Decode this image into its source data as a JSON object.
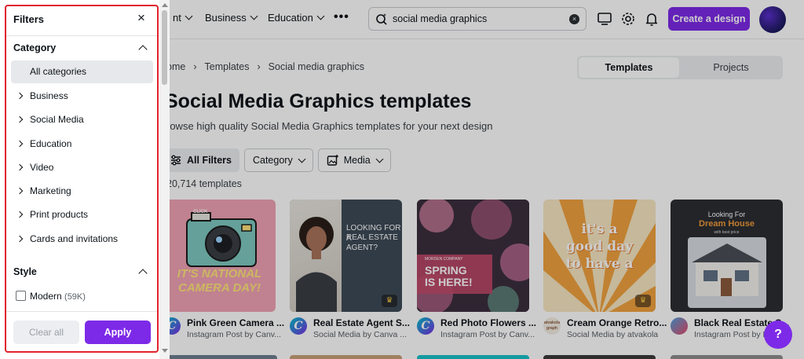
{
  "header": {
    "nav": [
      {
        "label": "nt"
      },
      {
        "label": "Business"
      },
      {
        "label": "Education"
      }
    ],
    "more_label": "•••",
    "search": {
      "value": "social media graphics"
    },
    "create_label": "Create a design"
  },
  "breadcrumb": [
    "ome",
    "›",
    "Templates",
    "›",
    "Social media graphics"
  ],
  "tabs": {
    "active": "Templates",
    "other": "Projects"
  },
  "page": {
    "title": "Social Media Graphics templates",
    "subtitle": "rowse high quality Social Media Graphics templates for your next design"
  },
  "filters": {
    "all_label": "All Filters",
    "category_label": "Category",
    "media_label": "Media"
  },
  "result_count": "20,714 templates",
  "cards": [
    {
      "title": "Pink Green Camera ...",
      "sub": "Instagram Post by Canv...",
      "logo": "C",
      "bg": "#f0a3b5",
      "art_top": "IT'S NATIONAL",
      "art_bottom": "CAMERA DAY!",
      "art_small": "CLICK"
    },
    {
      "title": "Real Estate Agent S...",
      "sub": "Social Media by Canva ...",
      "logo": "C",
      "bg": "#3e4a57",
      "art_top": "LOOKING FOR A",
      "art_bottom": "REAL ESTATE",
      "art_small": "AGENT?"
    },
    {
      "title": "Red Photo Flowers ...",
      "sub": "Instagram Post by Canv...",
      "logo": "C",
      "bg": "#5a3b4c",
      "art_top": "SPRING",
      "art_bottom": "IS HERE!",
      "art_small": "MORDEN COMPANY"
    },
    {
      "title": "Cream Orange Retro...",
      "sub": "Social Media by atvakola",
      "logo": "atvakola graph",
      "bg": "#f6d9a8",
      "art_top": "it's a",
      "art_bottom": "good day",
      "art_small": "to have a"
    },
    {
      "title": "Black Real Estate S...",
      "sub": "Instagram Post by D...",
      "logo": "",
      "bg": "#2b2e33",
      "art_top": "Looking For",
      "art_bottom": "Dream House",
      "art_small": "with best price"
    }
  ],
  "panel": {
    "title": "Filters",
    "close": "×",
    "category_title": "Category",
    "all_categories": "All categories",
    "categories": [
      "Business",
      "Social Media",
      "Education",
      "Video",
      "Marketing",
      "Print products",
      "Cards and invitations"
    ],
    "style_title": "Style",
    "style_option": {
      "label": "Modern",
      "count": "(59K)"
    },
    "clear_label": "Clear all",
    "apply_label": "Apply"
  },
  "help_label": "?",
  "colors": {
    "accent": "#7d2ae8",
    "frame": "#e2232b"
  }
}
